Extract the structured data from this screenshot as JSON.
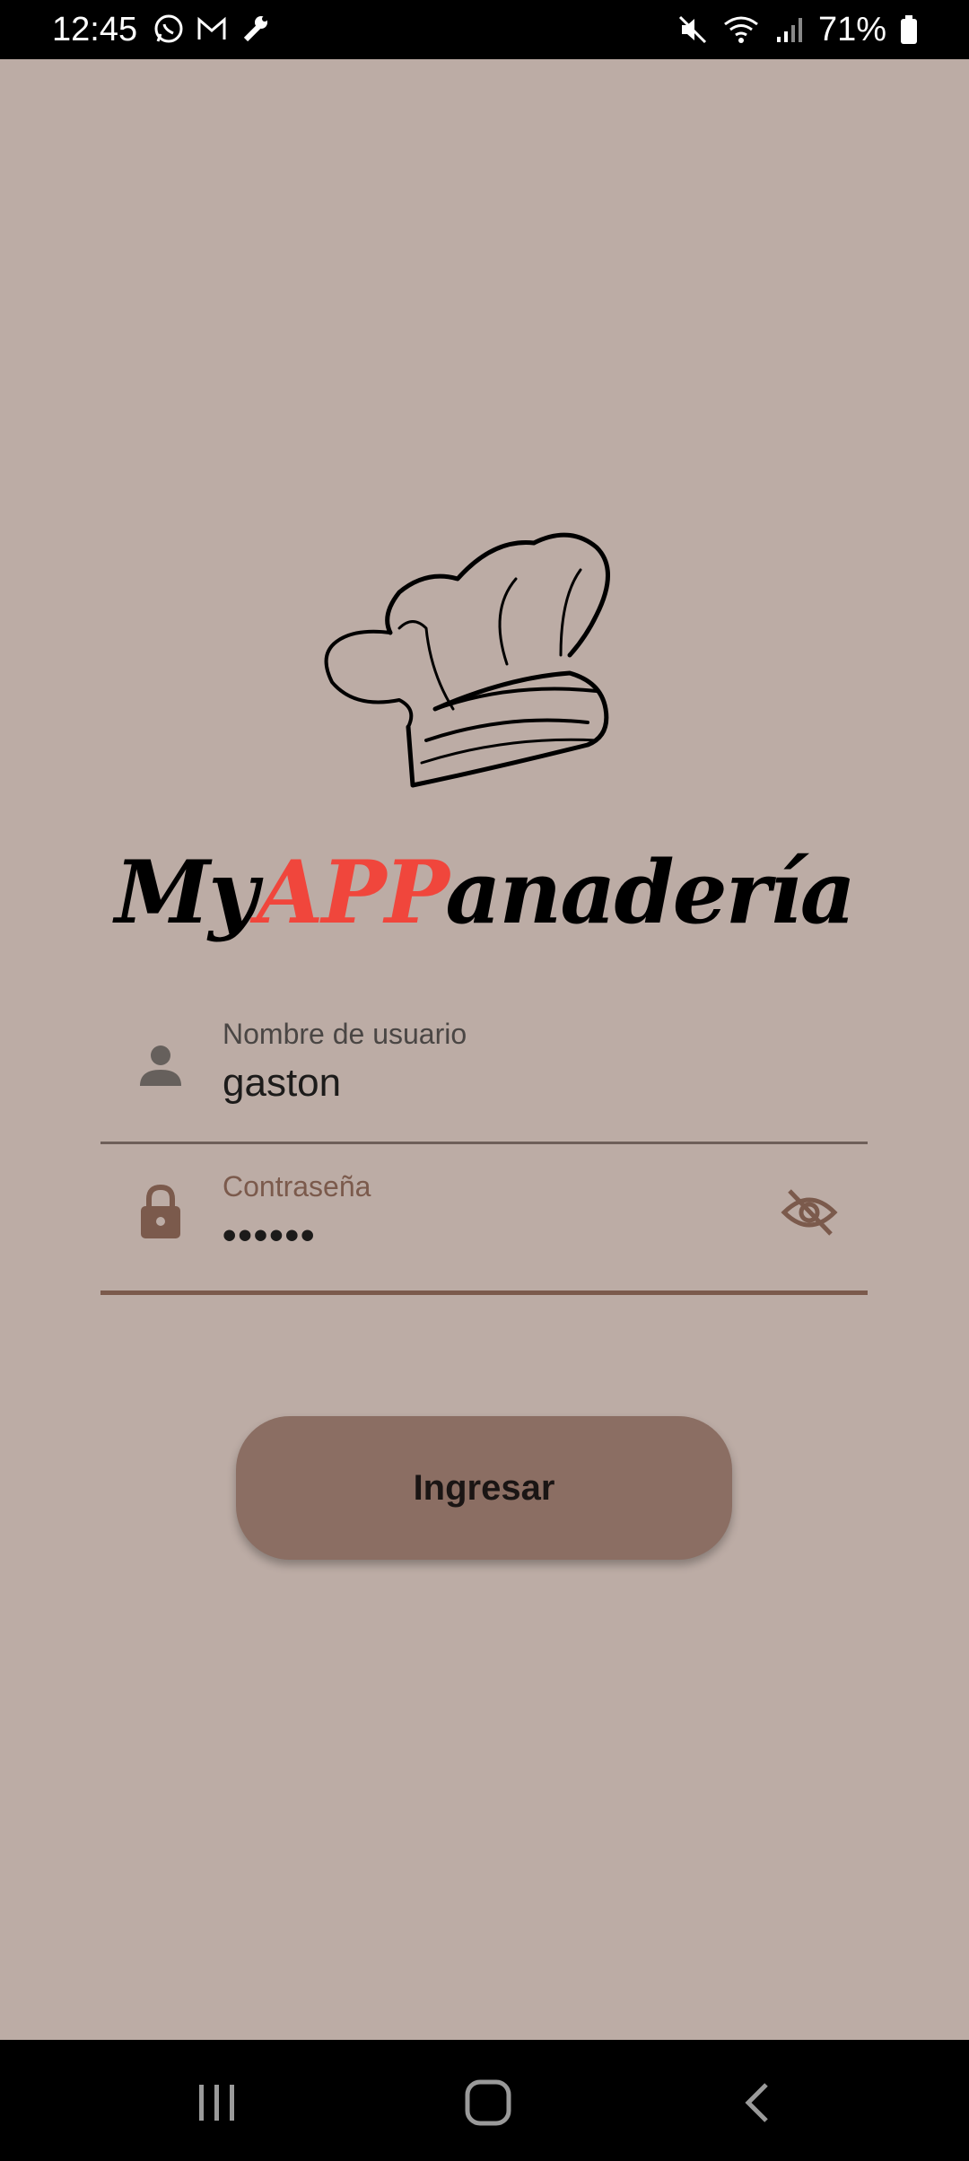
{
  "status_bar": {
    "time": "12:45",
    "battery": "71%",
    "left_icons": [
      "whatsapp-icon",
      "gmail-icon",
      "wrench-icon"
    ],
    "right_icons": [
      "mute-icon",
      "wifi-icon",
      "signal-icon",
      "battery-icon"
    ]
  },
  "logo": {
    "icon": "chef-hat-icon",
    "word_part1": "My",
    "word_part2": "APP",
    "word_part3": "anadería",
    "accent_color": "#f0463c"
  },
  "form": {
    "username": {
      "label": "Nombre de usuario",
      "value": "gaston",
      "icon": "person-icon"
    },
    "password": {
      "label": "Contraseña",
      "value": "••••••",
      "icon": "lock-icon",
      "toggle_icon": "visibility-off-icon"
    }
  },
  "submit": {
    "label": "Ingresar"
  },
  "nav_bar": {
    "items": [
      "recents-icon",
      "home-icon",
      "back-icon"
    ]
  },
  "colors": {
    "background": "#bcaca5",
    "button": "#8b6e63",
    "accent_label": "#7b5a4c"
  }
}
